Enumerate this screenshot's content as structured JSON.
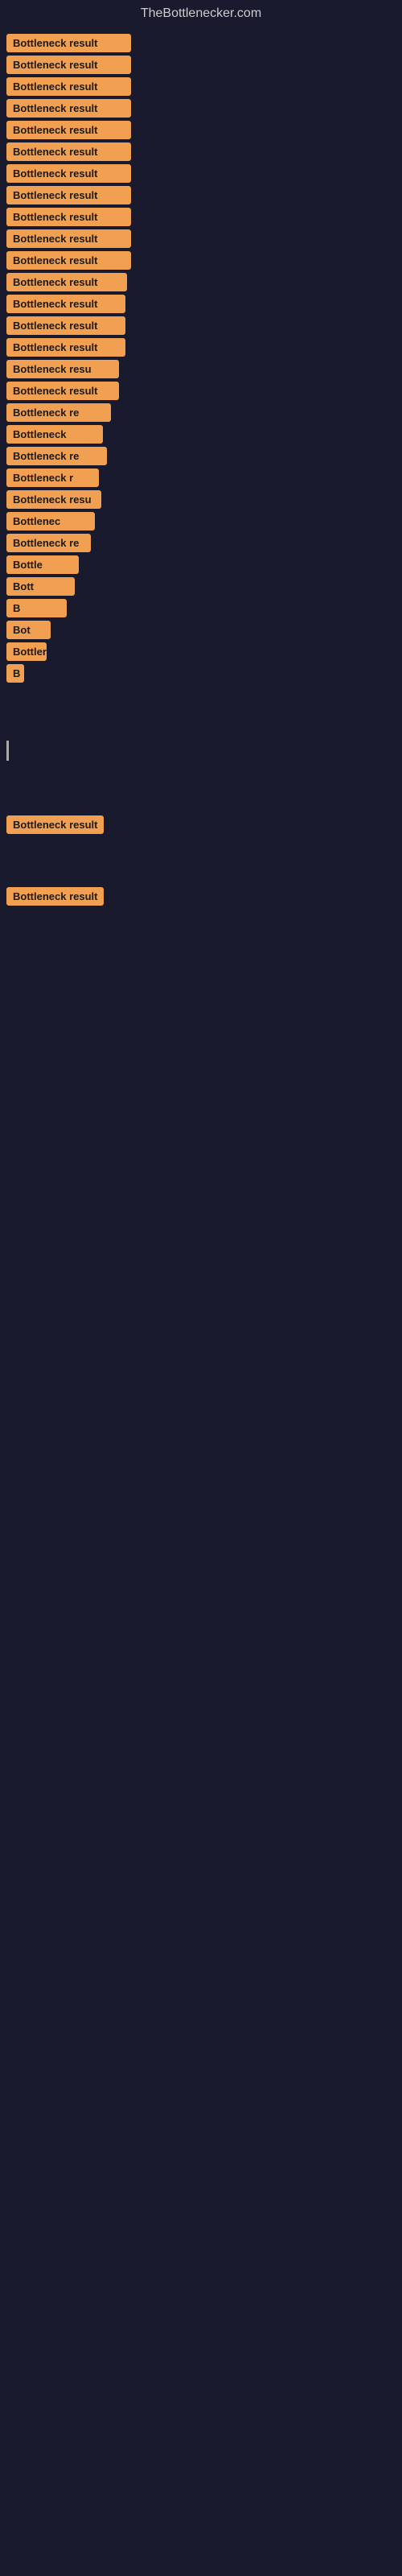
{
  "site": {
    "title": "TheBottlenecker.com"
  },
  "items": [
    {
      "label": "Bottleneck result",
      "width": 155
    },
    {
      "label": "Bottleneck result",
      "width": 155
    },
    {
      "label": "Bottleneck result",
      "width": 155
    },
    {
      "label": "Bottleneck result",
      "width": 155
    },
    {
      "label": "Bottleneck result",
      "width": 155
    },
    {
      "label": "Bottleneck result",
      "width": 155
    },
    {
      "label": "Bottleneck result",
      "width": 155
    },
    {
      "label": "Bottleneck result",
      "width": 155
    },
    {
      "label": "Bottleneck result",
      "width": 155
    },
    {
      "label": "Bottleneck result",
      "width": 155
    },
    {
      "label": "Bottleneck result",
      "width": 155
    },
    {
      "label": "Bottleneck result",
      "width": 150
    },
    {
      "label": "Bottleneck result",
      "width": 148
    },
    {
      "label": "Bottleneck result",
      "width": 148
    },
    {
      "label": "Bottleneck result",
      "width": 148
    },
    {
      "label": "Bottleneck resu",
      "width": 140
    },
    {
      "label": "Bottleneck result",
      "width": 140
    },
    {
      "label": "Bottleneck re",
      "width": 130
    },
    {
      "label": "Bottleneck",
      "width": 120
    },
    {
      "label": "Bottleneck re",
      "width": 125
    },
    {
      "label": "Bottleneck r",
      "width": 115
    },
    {
      "label": "Bottleneck resu",
      "width": 118
    },
    {
      "label": "Bottlenec",
      "width": 110
    },
    {
      "label": "Bottleneck re",
      "width": 105
    },
    {
      "label": "Bottle",
      "width": 90
    },
    {
      "label": "Bott",
      "width": 85
    },
    {
      "label": "B",
      "width": 75
    },
    {
      "label": "Bot",
      "width": 55
    },
    {
      "label": "Bottler",
      "width": 50
    },
    {
      "label": "B",
      "width": 22
    },
    {
      "label": "",
      "width": 0
    },
    {
      "label": "",
      "width": 0
    },
    {
      "label": "",
      "width": 0
    }
  ],
  "bottom_items": [
    {
      "label": "Bottleneck result",
      "width": 155
    },
    {
      "label": "Bottleneck result",
      "width": 155
    }
  ]
}
